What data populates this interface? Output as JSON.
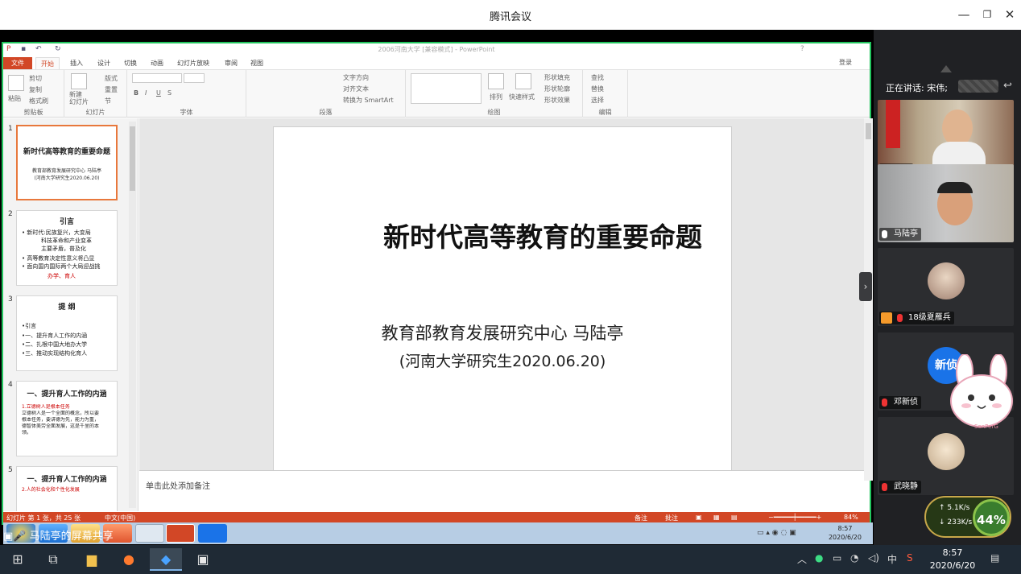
{
  "window": {
    "title": "腾讯会议",
    "minimize": "—",
    "restore": "❐",
    "close": "✕"
  },
  "ppt": {
    "doc_title": "2006河南大学 [兼容模式] - PowerPoint",
    "help": "?",
    "tabs": [
      "文件",
      "开始",
      "插入",
      "设计",
      "切换",
      "动画",
      "幻灯片放映",
      "审阅",
      "视图"
    ],
    "active_tab": "开始",
    "login": "登录",
    "ribbon": {
      "clipboard": {
        "label": "剪贴板",
        "paste": "粘贴",
        "cut": "剪切",
        "copy": "复制",
        "format_painter": "格式刷"
      },
      "slides": {
        "label": "幻灯片",
        "new_slide": "新建\n幻灯片",
        "layout": "版式",
        "reset": "重置",
        "section": "节"
      },
      "font": {
        "label": "字体",
        "bold": "B",
        "italic": "I",
        "underline": "U",
        "shadow": "S"
      },
      "paragraph": {
        "label": "段落",
        "text_direction": "文字方向",
        "align_text": "对齐文本",
        "smartart": "转换为 SmartArt"
      },
      "drawing": {
        "label": "绘图",
        "arrange": "排列",
        "quick_styles": "快速样式",
        "shape_fill": "形状填充",
        "shape_outline": "形状轮廓",
        "shape_effects": "形状效果"
      },
      "editing": {
        "label": "编辑",
        "find": "查找",
        "replace": "替换",
        "select": "选择"
      }
    },
    "thumbnails": [
      {
        "num": "1",
        "title": "新时代高等教育的重要命题",
        "lines": [
          "教育部教育发展研究中心 马陆亭",
          "(河南大学研究生2020.06.20)"
        ]
      },
      {
        "num": "2",
        "title": "引言",
        "lines": [
          "• 新时代:民族复兴，大变局",
          "科技革命和产业变革",
          "主要矛盾，普及化",
          "• 高等教育决定性意义将凸显",
          "• 面向国内国际两个大局迎战挑",
          "办学、育人"
        ]
      },
      {
        "num": "3",
        "title": "提 纲",
        "lines": [
          "•引言",
          "•一、提升育人工作的内涵",
          "•二、扎根中国大地办大学",
          "•三、推动实现结构化育人"
        ]
      },
      {
        "num": "4",
        "title": "一、提升育人工作的内涵",
        "lines": [
          "1.立德树人是根本任务",
          "立德树人是一个全面的概念，所以要",
          "根本任务，要讲德为先，能力为重，",
          "德智体美劳全面发展，这是千里的本",
          "领。"
        ]
      },
      {
        "num": "5",
        "title": "一、提升育人工作的内涵",
        "lines": [
          "2.人的社会化和个性化发展"
        ]
      }
    ],
    "slide": {
      "title": "新时代高等教育的重要命题",
      "subtitle": "教育部教育发展研究中心  马陆亭",
      "date": "(河南大学研究生2020.06.20)"
    },
    "notes_placeholder": "单击此处添加备注",
    "status": {
      "slide_count": "幻灯片 第 1 张，共 25 张",
      "language": "中文(中国)",
      "notes": "备注",
      "comments": "批注",
      "zoom": "84%"
    }
  },
  "remote_taskbar": {
    "time": "8:57",
    "date": "2020/6/20"
  },
  "share_label": "马陆亭的屏幕共享",
  "participants": {
    "speaking": "正在讲话: 宋伟;",
    "list": [
      {
        "name": "宋伟",
        "kind": "video"
      },
      {
        "name": "马陆亭",
        "kind": "video"
      },
      {
        "name": "18级夏雁兵",
        "kind": "avatar"
      },
      {
        "name": "邓新侦",
        "kind": "avatar",
        "avatar_text": "新侦"
      },
      {
        "name": "武晓静",
        "kind": "avatar"
      }
    ]
  },
  "sticker": {
    "label": "SonPerG"
  },
  "network": {
    "up": "5.1K/s",
    "down": "233K/s",
    "percent": "44%"
  },
  "taskbar": {
    "time": "8:57",
    "date": "2020/6/20",
    "ime": "中"
  },
  "colors": {
    "ppt_accent": "#d24726",
    "share_border": "#22c55e",
    "panel_bg": "#202124",
    "taskbar_bg": "#1f2a35"
  }
}
